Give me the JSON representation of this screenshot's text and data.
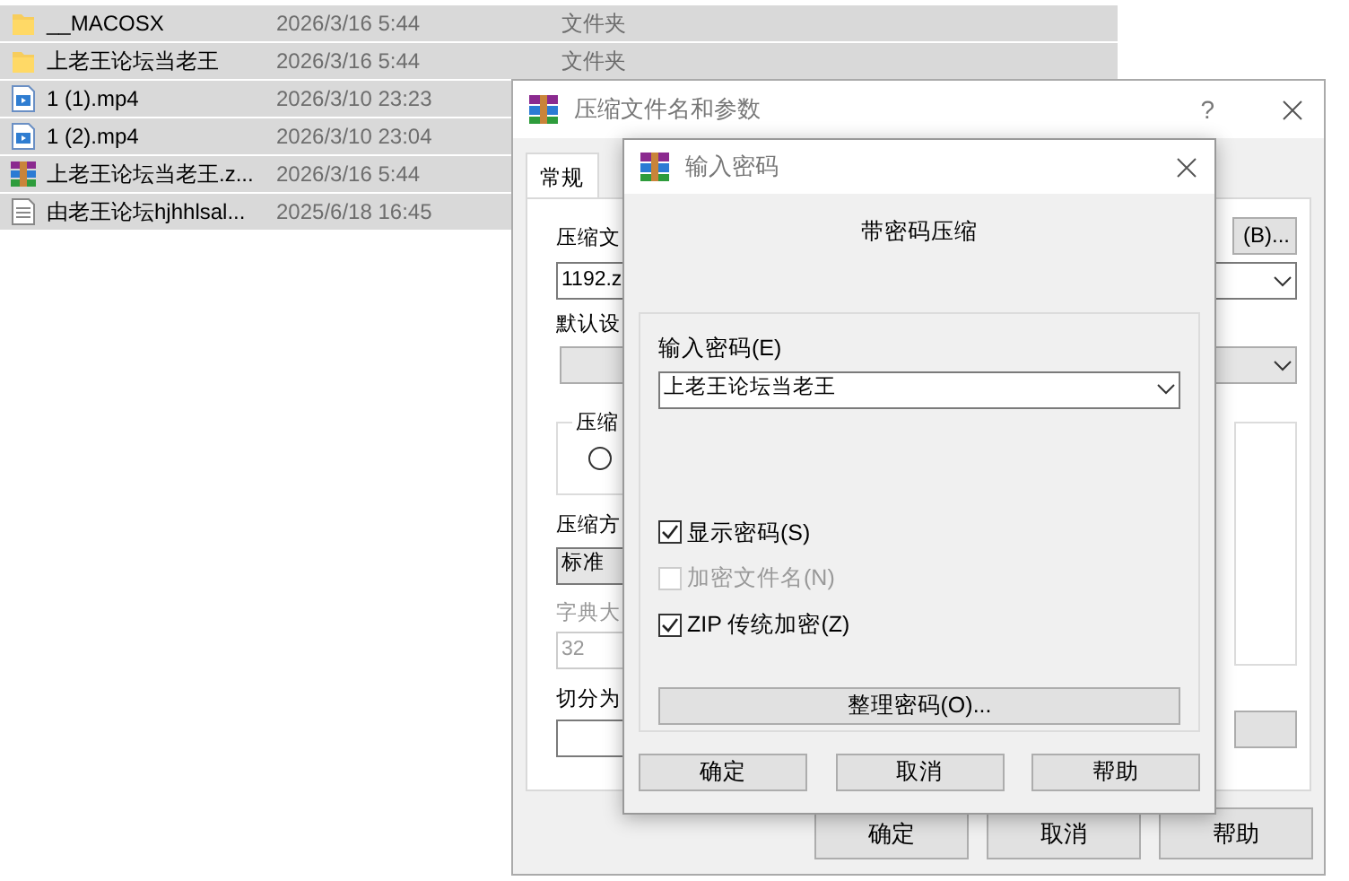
{
  "file_list": {
    "rows": [
      {
        "kind": "folder",
        "name": "__MACOSX",
        "date": "2026/3/16 5:44",
        "type": "文件夹",
        "selected": true
      },
      {
        "kind": "folder",
        "name": "上老王论坛当老王",
        "date": "2026/3/16 5:44",
        "type": "文件夹",
        "selected": true
      },
      {
        "kind": "video",
        "name": "1 (1).mp4",
        "date": "2026/3/10 23:23",
        "selected": true
      },
      {
        "kind": "video",
        "name": "1 (2).mp4",
        "date": "2026/3/10 23:04",
        "selected": true
      },
      {
        "kind": "archive",
        "name": "上老王论坛当老王.z...",
        "date": "2026/3/16 5:44",
        "selected": true
      },
      {
        "kind": "text",
        "name": "由老王论坛hjhhlsal...",
        "date": "2025/6/18 16:45",
        "selected": true
      }
    ]
  },
  "archive_dialog": {
    "title": "压缩文件名和参数",
    "help": "?",
    "tabs": [
      {
        "label": "常规",
        "selected": true
      }
    ],
    "archive_name_label": "压缩文",
    "browse_button": "(B)...",
    "archive_name": "1192.z",
    "profile_label": "默认设",
    "format_group": {
      "label": "压缩",
      "radios": [
        {
          "selected": false
        }
      ]
    },
    "method_label": "压缩方",
    "method": "标准",
    "dictionary_label": "字典大",
    "dictionary": "32",
    "split_label": "切分为",
    "buttons": [
      "确定",
      "取消",
      "帮助"
    ]
  },
  "password_dialog": {
    "title": "输入密码",
    "heading": "带密码压缩",
    "password_label": "输入密码(E)",
    "password": "上老王论坛当老王",
    "options": [
      {
        "label": "显示密码(S)",
        "checked": true,
        "disabled": false
      },
      {
        "label": "加密文件名(N)",
        "checked": false,
        "disabled": true
      },
      {
        "label": "ZIP 传统加密(Z)",
        "checked": true,
        "disabled": false
      }
    ],
    "organize_button": "整理密码(O)...",
    "buttons": [
      "确定",
      "取消",
      "帮助"
    ]
  }
}
